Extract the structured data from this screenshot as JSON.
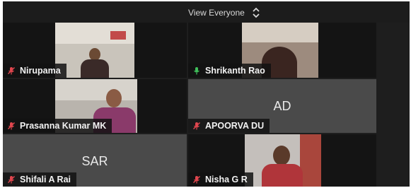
{
  "header": {
    "view_label": "View Everyone",
    "view_icon": "chevron-up-down-icon"
  },
  "colors": {
    "mic_muted": "#e0464e",
    "mic_active": "#3fbf5a",
    "tile_bg": "#4a4a4a",
    "app_bg": "#1e1e1e"
  },
  "participants": [
    {
      "name": "Nirupama",
      "mic": "muted",
      "video": true
    },
    {
      "name": "Shrikanth Rao",
      "mic": "active",
      "video": true
    },
    {
      "name": "Prasanna Kumar MK",
      "mic": "muted",
      "video": true
    },
    {
      "name": "APOORVA DU",
      "initials": "AD",
      "mic": "muted",
      "video": false
    },
    {
      "name": "Shifali A Rai",
      "initials": "SAR",
      "mic": "muted",
      "video": false
    },
    {
      "name": "Nisha G R",
      "mic": "muted",
      "video": true
    }
  ]
}
